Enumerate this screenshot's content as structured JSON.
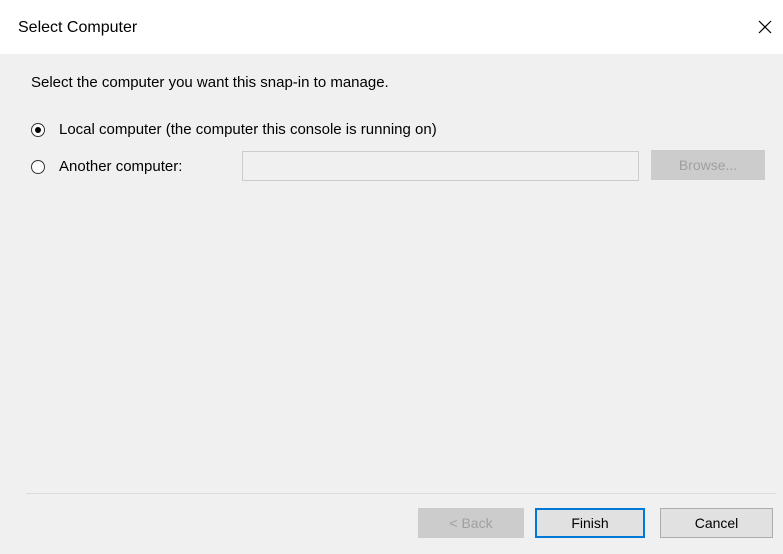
{
  "dialog": {
    "title": "Select Computer",
    "close_icon": "close-icon"
  },
  "instruction": "Select the computer you want this snap-in to manage.",
  "options": {
    "local": {
      "label": "Local computer (the computer this console is running on)",
      "selected": true
    },
    "another": {
      "label": "Another computer:",
      "selected": false,
      "input_value": "",
      "browse_label": "Browse..."
    }
  },
  "buttons": {
    "back": "< Back",
    "finish": "Finish",
    "cancel": "Cancel"
  },
  "colors": {
    "default_button_border": "#0078d7",
    "client_background": "#f0f0f0"
  }
}
